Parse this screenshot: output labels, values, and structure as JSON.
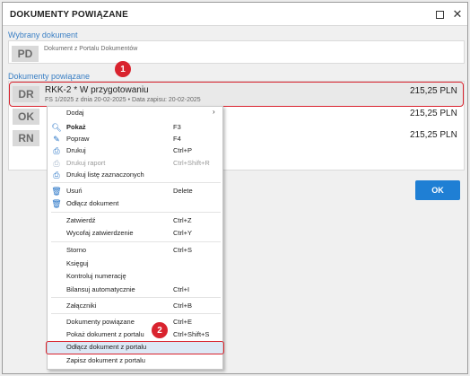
{
  "window": {
    "title": "DOKUMENTY POWIĄZANE"
  },
  "selected_document": {
    "label": "Wybrany dokument",
    "badge": "PD",
    "text": "Dokument z Portalu Dokumentów"
  },
  "related_documents": {
    "label": "Dokumenty powiązane",
    "rows": [
      {
        "badge": "DR",
        "title": "RKK-2 * W przygotowaniu",
        "sub": "FS 1/2025 z dnia 20-02-2025 • Data zapisu: 20-02-2025",
        "amount": "215,25 PLN"
      },
      {
        "badge": "OK",
        "title": "",
        "sub": "",
        "amount": "215,25 PLN"
      },
      {
        "badge": "RN",
        "title": "",
        "sub": "",
        "amount": "215,25 PLN"
      }
    ]
  },
  "ok_button": "OK",
  "callouts": [
    "1",
    "2"
  ],
  "menu": {
    "items": [
      {
        "label": "Dodaj",
        "shortcut": "",
        "icon": "",
        "submenu": true
      },
      {
        "label": "Pokaż",
        "shortcut": "F3",
        "icon": "search-icon",
        "bold": true
      },
      {
        "label": "Popraw",
        "shortcut": "F4",
        "icon": "pencil-icon"
      },
      {
        "label": "Drukuj",
        "shortcut": "Ctrl+P",
        "icon": "printer-icon"
      },
      {
        "label": "Drukuj raport",
        "shortcut": "Ctrl+Shift+R",
        "icon": "printer-icon",
        "disabled": true
      },
      {
        "label": "Drukuj listę zaznaczonych",
        "shortcut": "",
        "icon": "printer-icon"
      },
      {
        "label": "Usuń",
        "shortcut": "Delete",
        "icon": "trash-icon"
      },
      {
        "label": "Odłącz dokument",
        "shortcut": "",
        "icon": "trash-icon"
      },
      {
        "label": "Zatwierdź",
        "shortcut": "Ctrl+Z",
        "icon": ""
      },
      {
        "label": "Wycofaj zatwierdzenie",
        "shortcut": "Ctrl+Y",
        "icon": ""
      },
      {
        "label": "Storno",
        "shortcut": "Ctrl+S",
        "icon": ""
      },
      {
        "label": "Księguj",
        "shortcut": "",
        "icon": ""
      },
      {
        "label": "Kontroluj numerację",
        "shortcut": "",
        "icon": ""
      },
      {
        "label": "Bilansuj automatycznie",
        "shortcut": "Ctrl+I",
        "icon": ""
      },
      {
        "label": "Załączniki",
        "shortcut": "Ctrl+B",
        "icon": ""
      },
      {
        "label": "Dokumenty powiązane",
        "shortcut": "Ctrl+E",
        "icon": ""
      },
      {
        "label": "Pokaż dokument z portalu",
        "shortcut": "Ctrl+Shift+S",
        "icon": ""
      },
      {
        "label": "Odłącz dokument z portalu",
        "shortcut": "",
        "icon": ""
      },
      {
        "label": "Zapisz dokument z portalu",
        "shortcut": "",
        "icon": ""
      }
    ]
  },
  "colors": {
    "accent": "#1f7fd4",
    "highlight_red": "#d9232e",
    "label_blue": "#3a7fc4"
  }
}
